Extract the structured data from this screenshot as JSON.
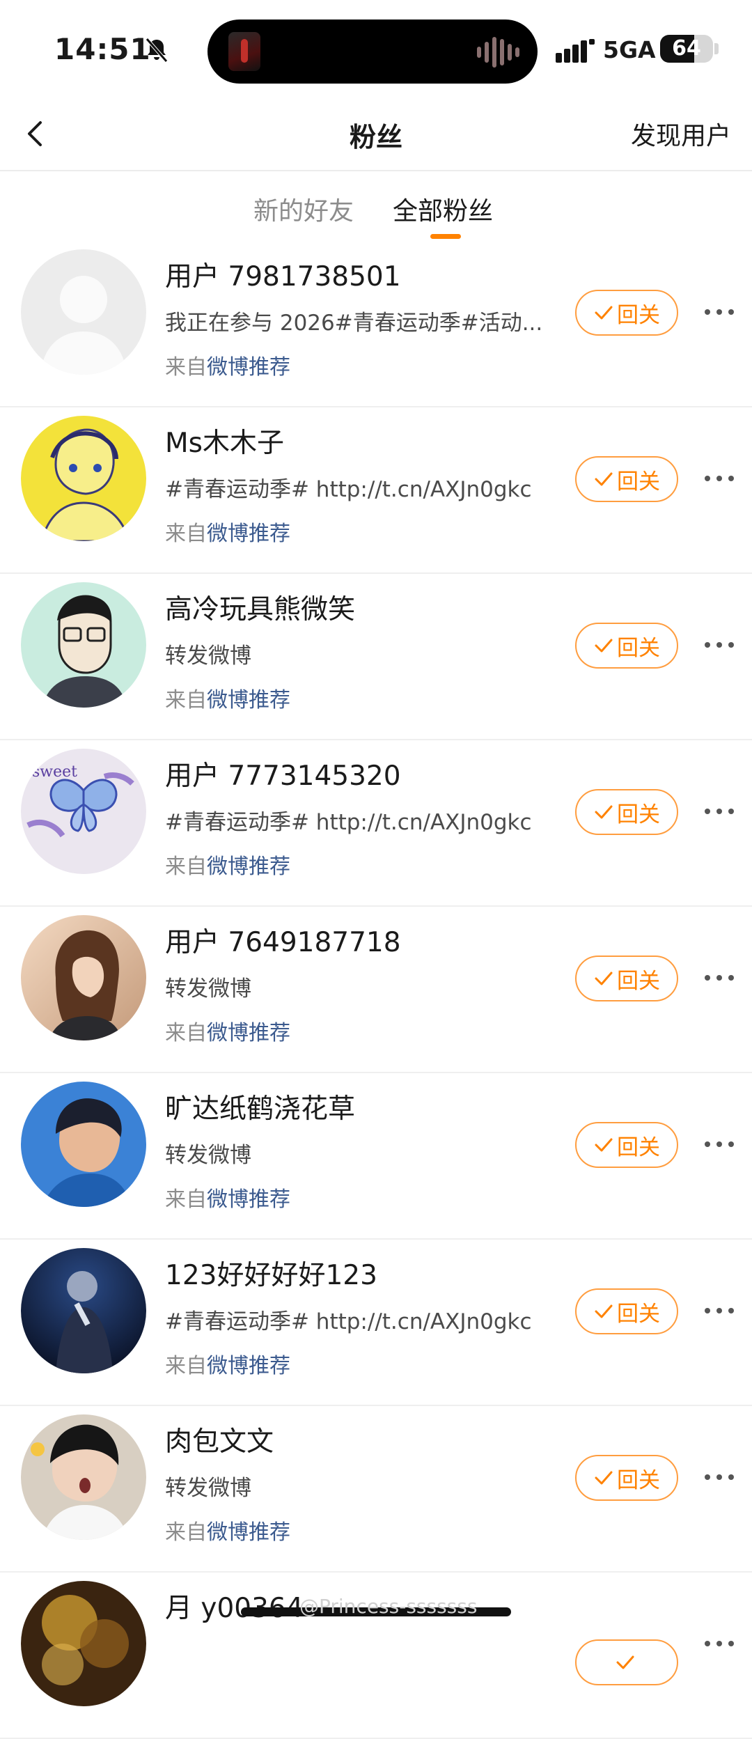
{
  "status_bar": {
    "time": "14:51",
    "network": "5GA",
    "battery": "64",
    "battery_level": 0.64,
    "icons": [
      "bell-muted-icon",
      "signal-icon",
      "battery-icon"
    ]
  },
  "nav": {
    "title": "粉丝",
    "right_action": "发现用户",
    "back_icon": "chevron-left-icon"
  },
  "tabs": [
    {
      "label": "新的好友",
      "active": false
    },
    {
      "label": "全部粉丝",
      "active": true
    }
  ],
  "colors": {
    "accent": "#ff8200",
    "link": "#3b5a8e"
  },
  "fans": [
    {
      "name": "用户 7981738501",
      "desc": "我正在参与 2026#青春运动季#活动...",
      "source_prefix": "来自",
      "source_link": "微博推荐",
      "button": "回关",
      "avatar": "default-avatar"
    },
    {
      "name": "Ms木木子",
      "desc": "#青春运动季# http://t.cn/AXJn0gkc",
      "source_prefix": "来自",
      "source_link": "微博推荐",
      "button": "回关",
      "avatar": "yellow-drawing-avatar"
    },
    {
      "name": "高冷玩具熊微笑",
      "desc": "转发微博",
      "source_prefix": "来自",
      "source_link": "微博推荐",
      "button": "回关",
      "avatar": "cartoon-glasses-avatar"
    },
    {
      "name": "用户 7773145320",
      "desc": "#青春运动季# http://t.cn/AXJn0gkc",
      "source_prefix": "来自",
      "source_link": "微博推荐",
      "button": "回关",
      "avatar": "butterfly-sticker-avatar"
    },
    {
      "name": "用户 7649187718",
      "desc": "转发微博",
      "source_prefix": "来自",
      "source_link": "微博推荐",
      "button": "回关",
      "avatar": "girl-photo-avatar"
    },
    {
      "name": "旷达纸鹤浇花草",
      "desc": "转发微博",
      "source_prefix": "来自",
      "source_link": "微博推荐",
      "button": "回关",
      "avatar": "anime-boy-avatar"
    },
    {
      "name": "123好好好好123",
      "desc": "#青春运动季# http://t.cn/AXJn0gkc",
      "source_prefix": "来自",
      "source_link": "微博推荐",
      "button": "回关",
      "avatar": "stage-singer-avatar"
    },
    {
      "name": "肉包文文",
      "desc": "转发微博",
      "source_prefix": "来自",
      "source_link": "微博推荐",
      "button": "回关",
      "avatar": "surprised-boy-avatar"
    },
    {
      "name": "月 y00364",
      "desc": "",
      "source_prefix": "",
      "source_link": "",
      "button": "",
      "avatar": "blurry-gold-avatar"
    }
  ],
  "watermark": "@Princess-sssssss"
}
